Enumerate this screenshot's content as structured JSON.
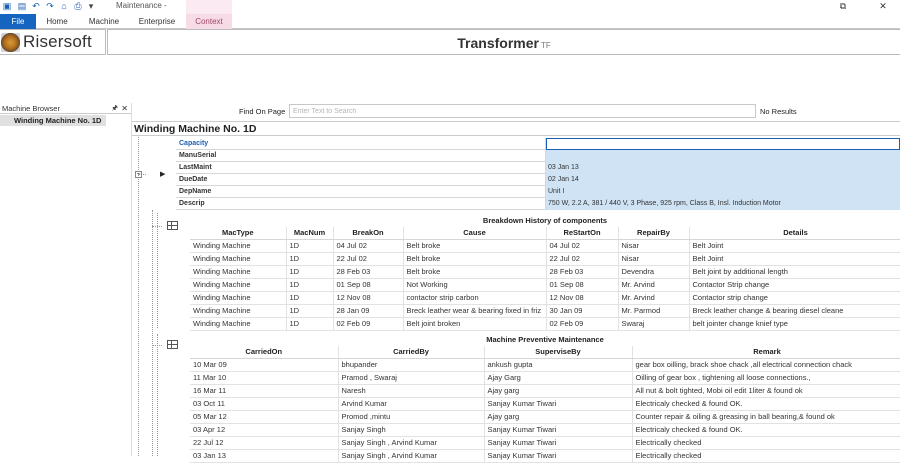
{
  "app": {
    "title": "Maintenance -",
    "qat_icons": [
      "folder-open-icon",
      "save-icon",
      "undo-icon",
      "redo-icon",
      "home-icon",
      "print-icon",
      "dropdown-icon"
    ]
  },
  "window": {
    "restore": "⧉",
    "close": "✕"
  },
  "tabs": [
    {
      "id": "file",
      "label": "File"
    },
    {
      "id": "home",
      "label": "Home"
    },
    {
      "id": "machine",
      "label": "Machine"
    },
    {
      "id": "enterprise",
      "label": "Enterprise"
    },
    {
      "id": "context",
      "label": "Context"
    }
  ],
  "header": {
    "logo_text": "Risersoft",
    "title": "Transformer",
    "subtitle": "TF"
  },
  "browser": {
    "title": "Machine Browser",
    "pin": "🖈",
    "close": "✕",
    "items": [
      "Winding Machine No. 1D"
    ]
  },
  "find": {
    "label": "Find On Page",
    "placeholder": "Enter Text to Search",
    "results": "No Results"
  },
  "record": {
    "title": "Winding Machine No. 1D",
    "collapse": "−",
    "current_row_marker": "▶",
    "properties": [
      {
        "name": "Capacity",
        "value": ""
      },
      {
        "name": "ManuSerial",
        "value": ""
      },
      {
        "name": "LastMaint",
        "value": "03 Jan 13"
      },
      {
        "name": "DueDate",
        "value": "02 Jan 14"
      },
      {
        "name": "DepName",
        "value": "Unit I"
      },
      {
        "name": "Descrip",
        "value": "750 W, 2.2 A, 381 / 440 V, 3 Phase, 925 rpm, Class B, Insl.  Induction Motor"
      }
    ]
  },
  "breakdown": {
    "caption": "Breakdown History of components",
    "columns": [
      "MacType",
      "MacNum",
      "BreakOn",
      "Cause",
      "ReStartOn",
      "RepairBy",
      "Details"
    ],
    "rows": [
      [
        "Winding Machine",
        "1D",
        "04 Jul 02",
        "Belt broke",
        "04 Jul 02",
        "Nisar",
        "Belt Joint"
      ],
      [
        "Winding Machine",
        "1D",
        "22 Jul 02",
        "Belt broke",
        "22 Jul 02",
        "Nisar",
        "Belt Joint"
      ],
      [
        "Winding Machine",
        "1D",
        "28 Feb 03",
        "Belt broke",
        "28 Feb 03",
        "Devendra",
        "Belt joint by additional length"
      ],
      [
        "Winding Machine",
        "1D",
        "01 Sep 08",
        "Not Working",
        "01 Sep 08",
        "Mr. Arvind",
        "Contactor Strip change"
      ],
      [
        "Winding Machine",
        "1D",
        "12 Nov 08",
        "contactor strip carbon",
        "12 Nov 08",
        "Mr. Arvind",
        "Contactor strip change"
      ],
      [
        "Winding Machine",
        "1D",
        "28 Jan 09",
        "Breck leather wear & bearing fixed in friz",
        "30 Jan 09",
        "Mr. Parmod",
        "Breck leather change & bearing diesel cleane"
      ],
      [
        "Winding Machine",
        "1D",
        "02 Feb 09",
        "Belt joint broken",
        "02 Feb 09",
        "Swaraj",
        "belt jointer change knief type"
      ]
    ]
  },
  "preventive": {
    "caption": "Machine Preventive Maintenance",
    "columns": [
      "CarriedOn",
      "CarriedBy",
      "SuperviseBy",
      "Remark"
    ],
    "rows": [
      [
        "10 Mar 09",
        "bhupander",
        "ankush gupta",
        "gear box oilling, brack shoe chack ,all electrical connection chack"
      ],
      [
        "11 Mar 10",
        "Pramod , Swaraj",
        "Ajay Garg",
        "Oilling of gear box , tightening all loose connections.,"
      ],
      [
        "16 Mar 11",
        "Naresh",
        "Ajay garg",
        "All nut & bolt tighted, Mobi oil edit 1liter & found ok"
      ],
      [
        "03 Oct 11",
        "Arvind Kumar",
        "Sanjay Kumar Tiwari",
        "Electricaly checked & found OK."
      ],
      [
        "05 Mar 12",
        "Promod ,mintu",
        "Ajay garg",
        "Counter repair & oiling & greasing in ball bearing,& found ok"
      ],
      [
        "03 Apr 12",
        "Sanjay Singh",
        "Sanjay Kumar Tiwari",
        "Electricaly checked & found OK."
      ],
      [
        "22 Jul 12",
        "Sanjay Singh , Arvind Kumar",
        "Sanjay Kumar Tiwari",
        "Electrically checked"
      ],
      [
        "03 Jan 13",
        "Sanjay Singh , Arvind Kumar",
        "Sanjay Kumar Tiwari",
        "Electrically checked"
      ]
    ]
  },
  "colors": {
    "accent": "#1565c0",
    "context_tab": "#f7dbe6",
    "selection": "#cfe3f5"
  }
}
